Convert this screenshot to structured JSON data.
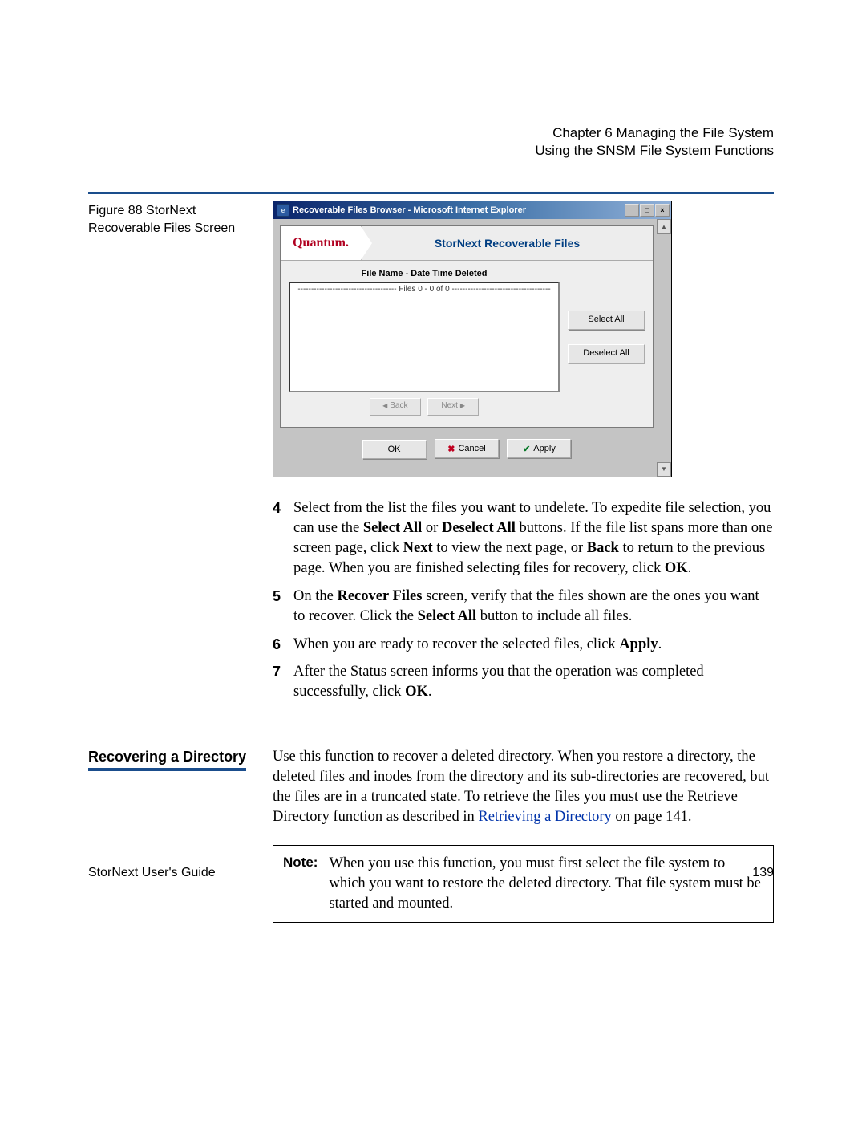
{
  "header": {
    "chapter": "Chapter 6  Managing the File System",
    "subtitle": "Using the SNSM File System Functions"
  },
  "figure": {
    "caption_a": "Figure 88  StorNext",
    "caption_b": "Recoverable Files Screen"
  },
  "window": {
    "title": "Recoverable Files Browser - Microsoft Internet Explorer",
    "brand": "Quantum.",
    "card_title": "StorNext Recoverable Files",
    "file_label": "File Name - Date Time Deleted",
    "file_range": "------------------------------------- Files 0 - 0 of 0 -------------------------------------",
    "select_all": "Select All",
    "deselect_all": "Deselect All",
    "back": "Back",
    "next": "Next",
    "ok": "OK",
    "cancel": "Cancel",
    "apply": "Apply"
  },
  "steps": {
    "n4": "4",
    "s4": "Select from the list the files you want to undelete. To expedite file selection, you can use the Select All or Deselect All buttons. If the file list spans more than one screen page, click Next to view the next page, or Back to return to the previous page. When you are finished selecting files for recovery, click OK.",
    "n5": "5",
    "s5": "On the Recover Files screen, verify that the files shown are the ones you want to recover. Click the Select All button to include all files.",
    "n6": "6",
    "s6": "When you are ready to recover the selected files, click Apply.",
    "n7": "7",
    "s7": "After the Status screen informs you that the operation was completed successfully, click OK."
  },
  "section": {
    "heading": "Recovering a Directory",
    "para": "Use this function to recover a deleted directory. When you restore a directory, the deleted files and inodes from the directory and its sub-directories are recovered, but the files are in a truncated state. To retrieve the files you must use the Retrieve Directory function as described in ",
    "link": "Retrieving a Directory",
    "link_suffix": " on page  141."
  },
  "note": {
    "label": "Note:",
    "text": "When you use this function, you must first select the file system to which you want to restore the deleted directory. That file system must be started and mounted."
  },
  "footer": {
    "left": "StorNext User's Guide",
    "right": "139"
  }
}
